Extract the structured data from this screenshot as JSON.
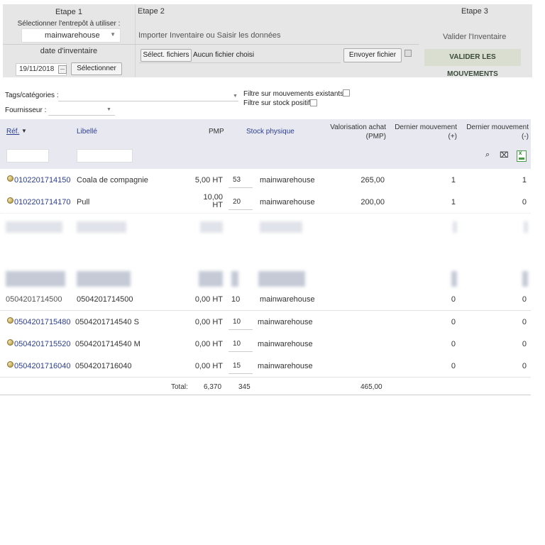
{
  "steps": {
    "step1": {
      "title": "Etape 1",
      "warehouse_label": "Sélectionner l'entrepôt à utiliser :",
      "warehouse_value": "mainwarehouse",
      "date_label": "date d'inventaire",
      "date_value": "19/11/2018",
      "select_button": "Sélectionner"
    },
    "step2": {
      "title": "Etape 2",
      "subtitle": "Importer Inventaire ou Saisir les données",
      "choose_files_button": "Sélect. fichiers",
      "no_file_text": "Aucun fichier choisi",
      "send_file_button": "Envoyer fichier"
    },
    "step3": {
      "title": "Etape 3",
      "subtitle": "Valider l'Inventaire",
      "validate_button": "VALIDER LES MOUVEMENTS"
    }
  },
  "filters": {
    "tags_label": "Tags/catégories :",
    "supplier_label": "Fournisseur :",
    "existing_movements_label": "Filtre sur mouvements existants",
    "positive_stock_label": "Filtre sur stock positif"
  },
  "table": {
    "headers": {
      "ref": "Réf.",
      "libelle": "Libellé",
      "pmp": "PMP",
      "stock": "Stock physique",
      "valorisation_1": "Valorisation achat",
      "valorisation_2": "(PMP)",
      "dernier_plus_1": "Dernier mouvement",
      "dernier_plus_2": "(+)",
      "dernier_moins_1": "Dernier mouvement",
      "dernier_moins_2": "(-)"
    },
    "rows": [
      {
        "ref": "0102201714150",
        "libelle": "Coala de compagnie",
        "pmp": "5,00 HT",
        "stock": "53",
        "warehouse": "mainwarehouse",
        "valorisation": "265,00",
        "dernier_plus": "1",
        "dernier_moins": "1"
      },
      {
        "ref": "0102201714170",
        "libelle": "Pull",
        "pmp_line1": "10,00",
        "pmp_line2": "HT",
        "stock": "20",
        "warehouse": "mainwarehouse",
        "valorisation": "200,00",
        "dernier_plus": "1",
        "dernier_moins": "0"
      },
      {
        "ref": "0504201714500",
        "libelle": "0504201714500",
        "pmp": "0,00 HT",
        "stock": "10",
        "warehouse": "mainwarehouse",
        "dernier_plus": "0",
        "dernier_moins": "0"
      },
      {
        "ref": "0504201715480",
        "libelle": "0504201714540 S",
        "pmp": "0,00 HT",
        "stock": "10",
        "warehouse": "mainwarehouse",
        "dernier_plus": "0",
        "dernier_moins": "0"
      },
      {
        "ref": "0504201715520",
        "libelle": "0504201714540 M",
        "pmp": "0,00 HT",
        "stock": "10",
        "warehouse": "mainwarehouse",
        "dernier_plus": "0",
        "dernier_moins": "0"
      },
      {
        "ref": "0504201716040",
        "libelle": "0504201716040",
        "pmp": "0,00 HT",
        "stock": "15",
        "warehouse": "mainwarehouse",
        "dernier_plus": "0",
        "dernier_moins": "0"
      }
    ],
    "totals": {
      "label": "Total:",
      "pmp": "6,370",
      "stock": "345",
      "valorisation": "465,00"
    }
  },
  "icons": {
    "sort": "caret-down-icon",
    "search": "search-icon",
    "clear_filter": "clear-filter-icon",
    "export": "excel-export-icon"
  },
  "colors": {
    "link": "#2b3e8f",
    "panel": "#e6e6e6",
    "header": "#e8e8f0",
    "validate_button": "#d9ded0"
  }
}
